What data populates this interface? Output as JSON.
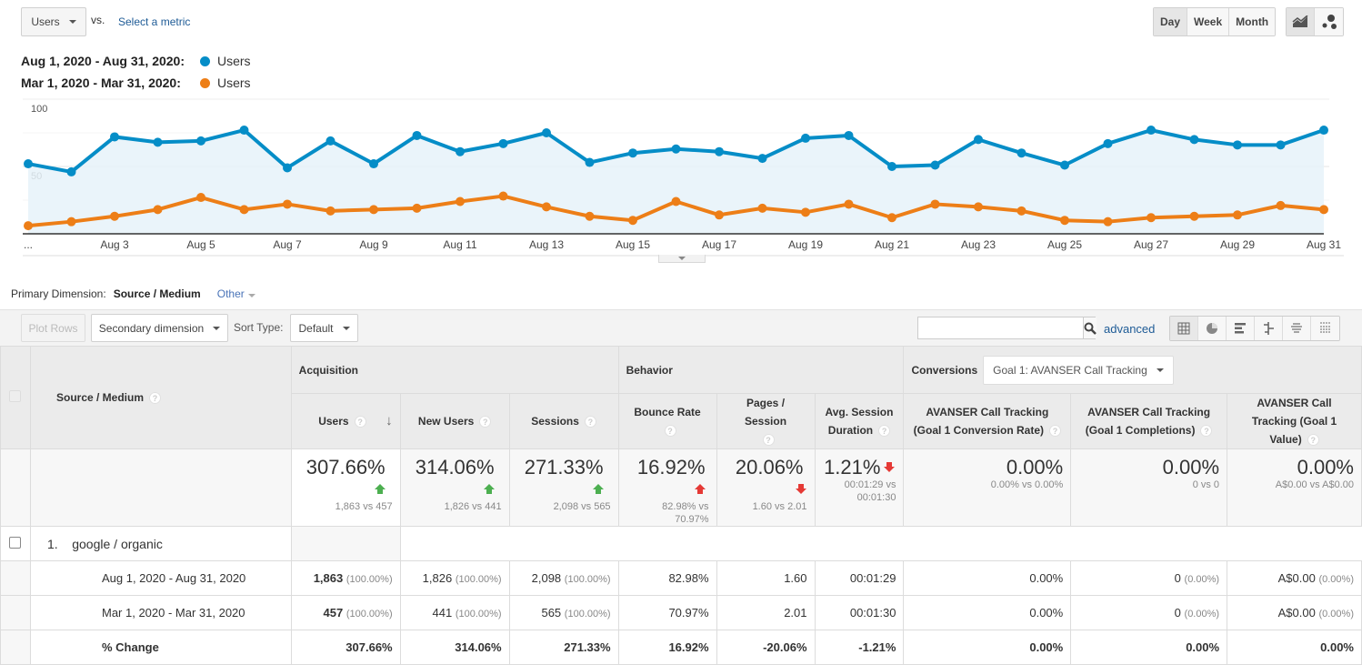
{
  "chart_controls": {
    "metric_select": "Users",
    "vs_label": "vs.",
    "select_metric_link": "Select a metric",
    "period_buttons": [
      "Day",
      "Week",
      "Month"
    ],
    "active_period": "Day",
    "chart_type_buttons": [
      "line-chart-icon",
      "motion-chart-icon"
    ]
  },
  "legend": [
    {
      "range": "Aug 1, 2020 - Aug 31, 2020:",
      "metric": "Users",
      "color": "#058dc7"
    },
    {
      "range": "Mar 1, 2020 - Mar 31, 2020:",
      "metric": "Users",
      "color": "#ed7e17"
    }
  ],
  "chart_data": {
    "type": "line",
    "title": "",
    "xlabel": "",
    "ylabel": "Users",
    "ylim": [
      0,
      100
    ],
    "yticks": [
      50,
      100
    ],
    "x": [
      "Aug 1",
      "Aug 2",
      "Aug 3",
      "Aug 4",
      "Aug 5",
      "Aug 6",
      "Aug 7",
      "Aug 8",
      "Aug 9",
      "Aug 10",
      "Aug 11",
      "Aug 12",
      "Aug 13",
      "Aug 14",
      "Aug 15",
      "Aug 16",
      "Aug 17",
      "Aug 18",
      "Aug 19",
      "Aug 20",
      "Aug 21",
      "Aug 22",
      "Aug 23",
      "Aug 24",
      "Aug 25",
      "Aug 26",
      "Aug 27",
      "Aug 28",
      "Aug 29",
      "Aug 30",
      "Aug 31"
    ],
    "xtick_labels": [
      "...",
      "",
      "Aug 3",
      "",
      "Aug 5",
      "",
      "Aug 7",
      "",
      "Aug 9",
      "",
      "Aug 11",
      "",
      "Aug 13",
      "",
      "Aug 15",
      "",
      "Aug 17",
      "",
      "Aug 19",
      "",
      "Aug 21",
      "",
      "Aug 23",
      "",
      "Aug 25",
      "",
      "Aug 27",
      "",
      "Aug 29",
      "",
      "Aug 31"
    ],
    "grid": true,
    "series": [
      {
        "name": "Aug 1, 2020 - Aug 31, 2020: Users",
        "color": "#058dc7",
        "area": true,
        "values": [
          52,
          46,
          72,
          68,
          69,
          77,
          49,
          69,
          52,
          73,
          61,
          67,
          75,
          53,
          60,
          63,
          61,
          56,
          71,
          73,
          50,
          51,
          70,
          60,
          51,
          67,
          77,
          70,
          66,
          66,
          77
        ]
      },
      {
        "name": "Mar 1, 2020 - Mar 31, 2020: Users",
        "color": "#ed7e17",
        "area": false,
        "values": [
          6,
          9,
          13,
          18,
          27,
          18,
          22,
          17,
          18,
          19,
          24,
          28,
          20,
          13,
          10,
          24,
          14,
          19,
          16,
          22,
          12,
          22,
          20,
          17,
          10,
          9,
          12,
          13,
          14,
          21,
          18
        ]
      }
    ]
  },
  "primary_dimension": {
    "label": "Primary Dimension:",
    "active": "Source / Medium",
    "other": "Other"
  },
  "toolbar": {
    "plot_rows": "Plot Rows",
    "secondary_dimension": "Secondary dimension",
    "sort_type_label": "Sort Type:",
    "sort_type_value": "Default",
    "search_placeholder": "",
    "advanced": "advanced"
  },
  "table": {
    "dimension_header": "Source / Medium",
    "groups": {
      "acquisition": "Acquisition",
      "behavior": "Behavior",
      "conversions": "Conversions",
      "goal_select": "Goal 1: AVANSER Call Tracking"
    },
    "columns": [
      "Users",
      "New Users",
      "Sessions",
      "Bounce Rate",
      "Pages / Session",
      "Avg. Session Duration",
      "AVANSER Call Tracking (Goal 1 Conversion Rate)",
      "AVANSER Call Tracking (Goal 1 Completions)",
      "AVANSER Call Tracking (Goal 1 Value)"
    ],
    "totals": [
      {
        "change": "307.66%",
        "dir": "up-good",
        "compare": "1,863 vs 457"
      },
      {
        "change": "314.06%",
        "dir": "up-good",
        "compare": "1,826 vs 441"
      },
      {
        "change": "271.33%",
        "dir": "up-good",
        "compare": "2,098 vs 565"
      },
      {
        "change": "16.92%",
        "dir": "up-bad",
        "compare": "82.98% vs 70.97%"
      },
      {
        "change": "20.06%",
        "dir": "down-bad",
        "compare": "1.60 vs 2.01"
      },
      {
        "change": "1.21%",
        "dir": "down-bad",
        "compare": "00:01:29 vs 00:01:30"
      },
      {
        "change": "0.00%",
        "dir": "",
        "compare": "0.00% vs 0.00%"
      },
      {
        "change": "0.00%",
        "dir": "",
        "compare": "0 vs 0"
      },
      {
        "change": "0.00%",
        "dir": "",
        "compare": "A$0.00 vs A$0.00"
      }
    ],
    "row": {
      "index": "1.",
      "name": "google / organic",
      "periods": [
        {
          "label": "Aug 1, 2020 - Aug 31, 2020",
          "values": [
            [
              "1,863",
              "(100.00%)"
            ],
            [
              "1,826",
              "(100.00%)"
            ],
            [
              "2,098",
              "(100.00%)"
            ],
            [
              "82.98%",
              ""
            ],
            [
              "1.60",
              ""
            ],
            [
              "00:01:29",
              ""
            ],
            [
              "0.00%",
              ""
            ],
            [
              "0",
              "(0.00%)"
            ],
            [
              "A$0.00",
              "(0.00%)"
            ]
          ]
        },
        {
          "label": "Mar 1, 2020 - Mar 31, 2020",
          "values": [
            [
              "457",
              "(100.00%)"
            ],
            [
              "441",
              "(100.00%)"
            ],
            [
              "565",
              "(100.00%)"
            ],
            [
              "70.97%",
              ""
            ],
            [
              "2.01",
              ""
            ],
            [
              "00:01:30",
              ""
            ],
            [
              "0.00%",
              ""
            ],
            [
              "0",
              "(0.00%)"
            ],
            [
              "A$0.00",
              "(0.00%)"
            ]
          ]
        }
      ],
      "change_label": "% Change",
      "change_values": [
        "307.66%",
        "314.06%",
        "271.33%",
        "16.92%",
        "-20.06%",
        "-1.21%",
        "0.00%",
        "0.00%",
        "0.00%"
      ]
    }
  }
}
